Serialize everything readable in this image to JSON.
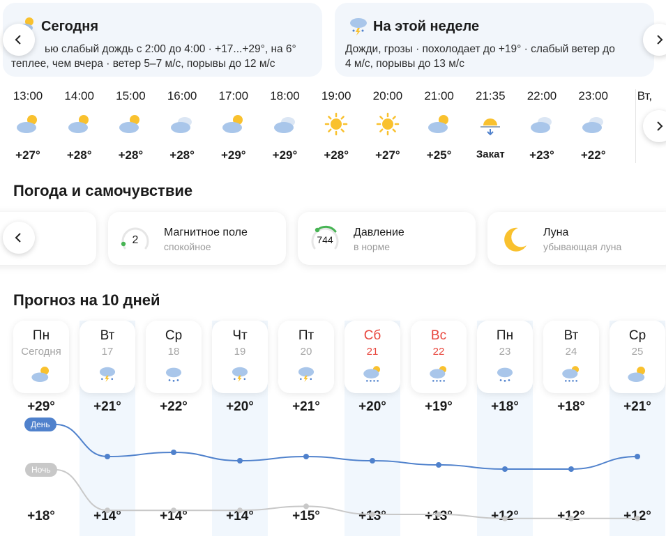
{
  "today_card": {
    "title": "Сегодня",
    "line1": "ью слабый дождь с 2:00 до 4:00 · +17...+29°, на 6°",
    "line2": "теплее, чем вчера · ветер 5–7 м/с, порывы до 12 м/с"
  },
  "week_card": {
    "title": "На этой неделе",
    "line1": "Дожди, грозы · похолодает до +19° · слабый ветер до",
    "line2": "4 м/с, порывы до 13 м/с"
  },
  "hourly": [
    {
      "time": "13:00",
      "icon": "partly-cloudy-icon",
      "temp": "+27°"
    },
    {
      "time": "14:00",
      "icon": "partly-cloudy-icon",
      "temp": "+28°"
    },
    {
      "time": "15:00",
      "icon": "partly-cloudy-icon",
      "temp": "+28°"
    },
    {
      "time": "16:00",
      "icon": "cloudy-icon",
      "temp": "+28°"
    },
    {
      "time": "17:00",
      "icon": "partly-cloudy-icon",
      "temp": "+29°"
    },
    {
      "time": "18:00",
      "icon": "cloudy-icon",
      "temp": "+29°"
    },
    {
      "time": "19:00",
      "icon": "sun-icon",
      "temp": "+28°"
    },
    {
      "time": "20:00",
      "icon": "sun-icon",
      "temp": "+27°"
    },
    {
      "time": "21:00",
      "icon": "partly-cloudy-icon",
      "temp": "+25°"
    },
    {
      "time": "21:35",
      "icon": "sunset-icon",
      "temp": "Закат"
    },
    {
      "time": "22:00",
      "icon": "cloudy-icon",
      "temp": "+23°"
    },
    {
      "time": "23:00",
      "icon": "cloudy-icon",
      "temp": "+22°"
    },
    {
      "time": "Вт,",
      "icon": "",
      "temp": ""
    }
  ],
  "wellbeing": {
    "title": "Погода и самочувствие",
    "magnetic": {
      "name": "Магнитное поле",
      "value": "2",
      "status": "спокойное"
    },
    "pressure": {
      "name": "Давление",
      "value": "744",
      "status": "в норме"
    },
    "moon": {
      "name": "Луна",
      "status": "убывающая луна"
    }
  },
  "forecast": {
    "title": "Прогноз на 10 дней",
    "day_label": "День",
    "night_label": "Ночь",
    "days": [
      {
        "name": "Пн",
        "date": "Сегодня",
        "icon": "partly-cloudy-icon",
        "max": "+29°",
        "min": "+18°",
        "weekend": false,
        "highlight": false
      },
      {
        "name": "Вт",
        "date": "17",
        "icon": "thunderstorm-icon",
        "max": "+21°",
        "min": "+14°",
        "weekend": false,
        "highlight": true
      },
      {
        "name": "Ср",
        "date": "18",
        "icon": "rain-icon",
        "max": "+22°",
        "min": "+14°",
        "weekend": false,
        "highlight": false
      },
      {
        "name": "Чт",
        "date": "19",
        "icon": "thunderstorm-icon",
        "max": "+20°",
        "min": "+14°",
        "weekend": false,
        "highlight": true
      },
      {
        "name": "Пт",
        "date": "20",
        "icon": "thunderstorm-icon",
        "max": "+21°",
        "min": "+15°",
        "weekend": false,
        "highlight": false
      },
      {
        "name": "Сб",
        "date": "21",
        "icon": "sun-rain-icon",
        "max": "+20°",
        "min": "+13°",
        "weekend": true,
        "highlight": true
      },
      {
        "name": "Вс",
        "date": "22",
        "icon": "sun-rain-icon",
        "max": "+19°",
        "min": "+13°",
        "weekend": true,
        "highlight": false
      },
      {
        "name": "Пн",
        "date": "23",
        "icon": "rain-icon",
        "max": "+18°",
        "min": "+12°",
        "weekend": false,
        "highlight": true
      },
      {
        "name": "Вт",
        "date": "24",
        "icon": "sun-rain-icon",
        "max": "+18°",
        "min": "+12°",
        "weekend": false,
        "highlight": false
      },
      {
        "name": "Ср",
        "date": "25",
        "icon": "partly-cloudy-icon",
        "max": "+21°",
        "min": "+12°",
        "weekend": false,
        "highlight": true
      }
    ]
  },
  "chart_data": {
    "type": "line",
    "categories": [
      "Пн",
      "Вт",
      "Ср",
      "Чт",
      "Пт",
      "Сб",
      "Вс",
      "Пн",
      "Вт",
      "Ср"
    ],
    "series": [
      {
        "name": "День",
        "values": [
          29,
          21,
          22,
          20,
          21,
          20,
          19,
          18,
          18,
          21
        ]
      },
      {
        "name": "Ночь",
        "values": [
          18,
          14,
          14,
          14,
          15,
          13,
          13,
          12,
          12,
          12
        ]
      }
    ],
    "colors": {
      "day": "#4f81cc",
      "night": "#c8c8c8"
    }
  }
}
